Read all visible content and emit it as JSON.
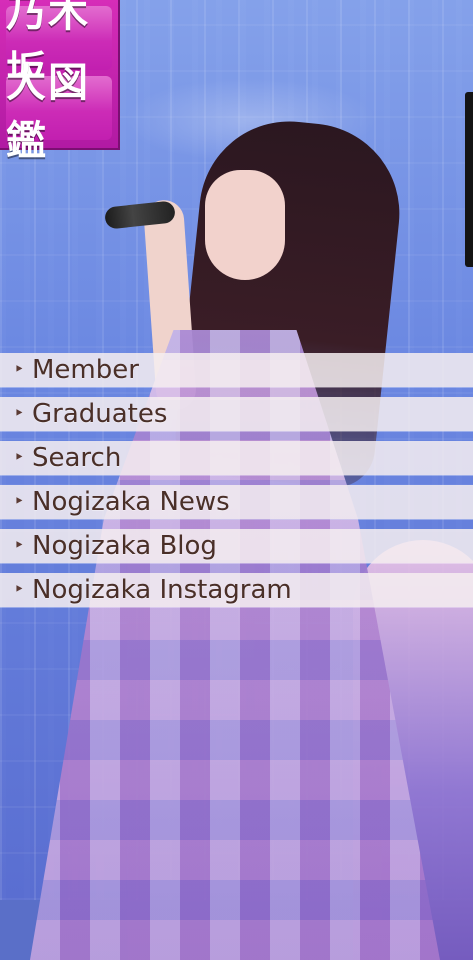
{
  "logo": {
    "line1": "乃木坂",
    "line2": "大図鑑"
  },
  "menu": {
    "bullet_glyph": "‣",
    "items": [
      {
        "label": "Member"
      },
      {
        "label": "Graduates"
      },
      {
        "label": "Search"
      },
      {
        "label": "Nogizaka News"
      },
      {
        "label": "Nogizaka Blog"
      },
      {
        "label": "Nogizaka Instagram"
      }
    ]
  },
  "colors": {
    "logo_magenta": "#c21fb0",
    "menu_band": "#f5eef0",
    "menu_text": "#4a2f28"
  },
  "icons": {
    "bullet": "bullet-icon"
  }
}
